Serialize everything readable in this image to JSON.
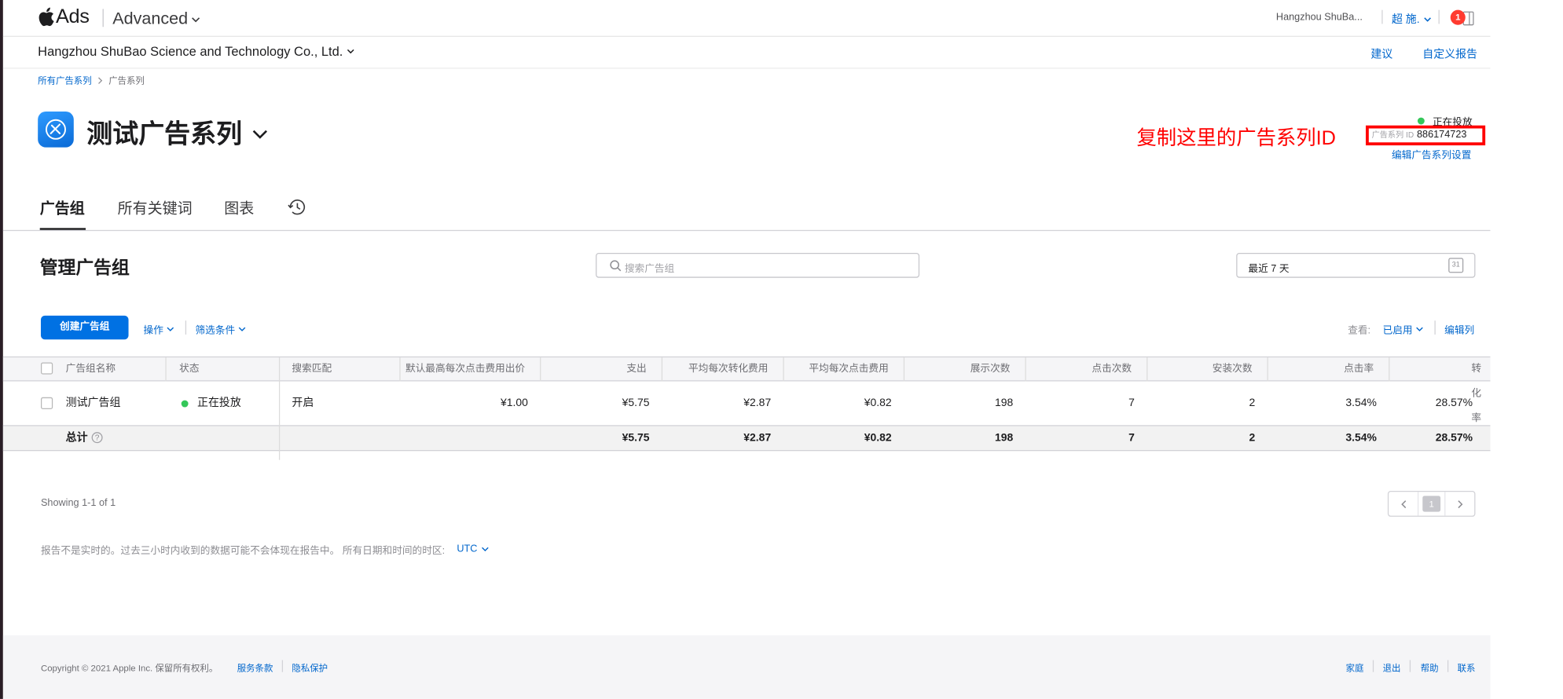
{
  "header": {
    "brand": "Ads",
    "product": "Advanced",
    "account_short": "Hangzhou ShuBa...",
    "user": "超 施.",
    "notification_count": "1"
  },
  "org_bar": {
    "org_name": "Hangzhou ShuBao Science and Technology Co., Ltd.",
    "suggestions": "建议",
    "custom_reports": "自定义报告"
  },
  "breadcrumb": {
    "root": "所有广告系列",
    "current": "广告系列"
  },
  "campaign": {
    "name": "测试广告系列",
    "status": "正在投放",
    "id_label": "广告系列 ID",
    "id_value": "886174723",
    "edit_settings": "编辑广告系列设置",
    "annotation": "复制这里的广告系列ID"
  },
  "tabs": [
    "广告组",
    "所有关键词",
    "图表"
  ],
  "manage": {
    "title": "管理广告组",
    "search_placeholder": "搜索广告组",
    "date_range": "最近 7 天",
    "calendar_day": "31"
  },
  "toolbar": {
    "create": "创建广告组",
    "actions": "操作",
    "filters": "筛选条件",
    "view_label": "查看:",
    "view_value": "已启用",
    "edit_columns": "编辑列"
  },
  "table": {
    "columns": [
      "广告组名称",
      "状态",
      "搜索匹配",
      "默认最高每次点击费用出价",
      "支出",
      "平均每次转化费用",
      "平均每次点击费用",
      "展示次数",
      "点击次数",
      "安装次数",
      "点击率",
      "转化率"
    ],
    "rows": [
      {
        "name": "测试广告组",
        "status": "正在投放",
        "search_match": "开启",
        "max_cpt_bid": "¥1.00",
        "spend": "¥5.75",
        "avg_cpa": "¥2.87",
        "avg_cpt": "¥0.82",
        "impressions": "198",
        "taps": "7",
        "installs": "2",
        "ttr": "3.54%",
        "conversion_rate": "28.57%"
      }
    ],
    "totals": {
      "label": "总计",
      "spend": "¥5.75",
      "avg_cpa": "¥2.87",
      "avg_cpt": "¥0.82",
      "impressions": "198",
      "taps": "7",
      "installs": "2",
      "ttr": "3.54%",
      "conversion_rate": "28.57%"
    }
  },
  "pagination": {
    "showing": "Showing 1-1 of 1",
    "current_page": "1"
  },
  "notice": {
    "text": "报告不是实时的。过去三小时内收到的数据可能不会体现在报告中。 所有日期和时间的时区:",
    "timezone": "UTC"
  },
  "footer": {
    "copyright": "Copyright © 2021 Apple Inc. 保留所有权利。",
    "terms": "服务条款",
    "privacy": "隐私保护",
    "links": [
      "家庭",
      "退出",
      "帮助",
      "联系"
    ]
  },
  "colors": {
    "accent": "#0071e3",
    "link": "#0066cc",
    "running": "#34c759",
    "annotation": "#ff0000",
    "badge": "#ff3b30"
  }
}
